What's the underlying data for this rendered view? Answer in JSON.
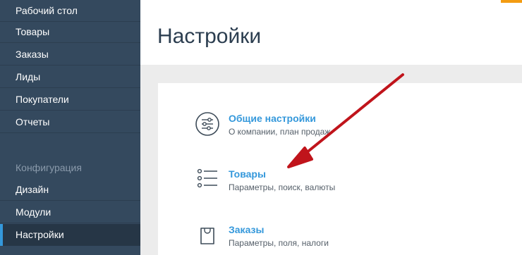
{
  "sidebar": {
    "items": [
      {
        "label": "Рабочий стол"
      },
      {
        "label": "Товары"
      },
      {
        "label": "Заказы"
      },
      {
        "label": "Лиды"
      },
      {
        "label": "Покупатели"
      },
      {
        "label": "Отчеты"
      }
    ],
    "config_heading": "Конфигурация",
    "config_items": [
      {
        "label": "Дизайн"
      },
      {
        "label": "Модули"
      },
      {
        "label": "Настройки",
        "active": true
      }
    ]
  },
  "header": {
    "title": "Настройки"
  },
  "settings": [
    {
      "title": "Общие настройки",
      "description": "О компании, план продаж",
      "icon": "sliders-icon"
    },
    {
      "title": "Товары",
      "description": "Параметры, поиск, валюты",
      "icon": "list-icon"
    },
    {
      "title": "Заказы",
      "description": "Параметры, поля, налоги",
      "icon": "shopping-bag-icon"
    }
  ],
  "colors": {
    "sidebar_bg": "#34495e",
    "sidebar_active_bg": "#263646",
    "accent": "#3498db",
    "annotation_arrow": "#c0141b",
    "corner_badge": "#f39c12"
  }
}
